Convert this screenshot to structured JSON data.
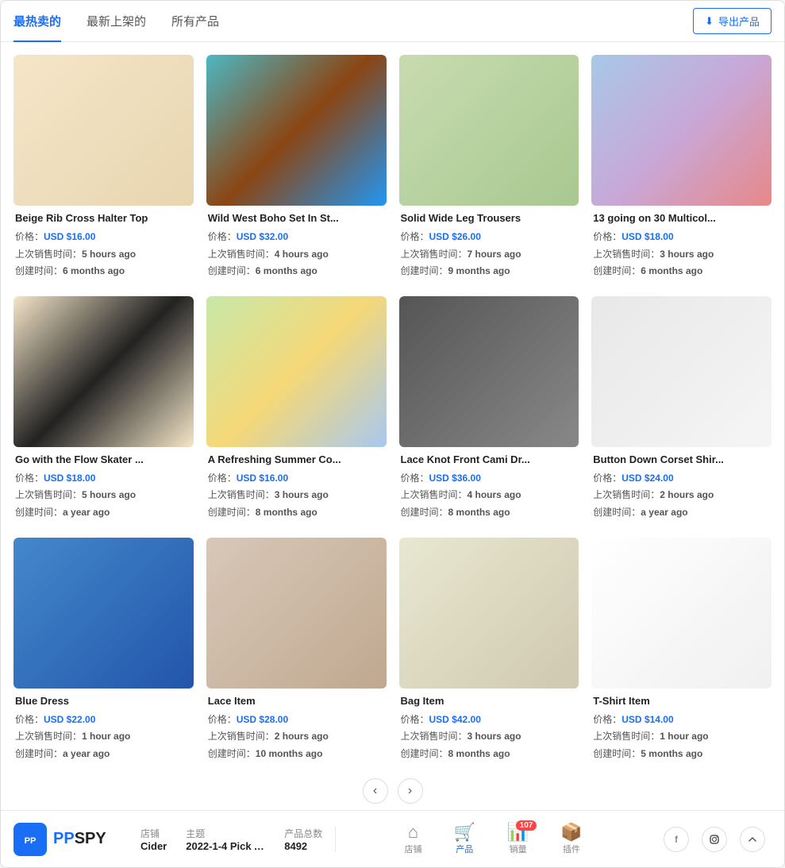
{
  "tabs": {
    "items": [
      {
        "label": "最热卖的",
        "active": true
      },
      {
        "label": "最新上架的",
        "active": false
      },
      {
        "label": "所有产品",
        "active": false
      }
    ],
    "export_label": "导出产品"
  },
  "products": [
    {
      "id": 1,
      "title": "Beige Rib Cross Halter Top",
      "price": "USD $16.00",
      "last_sold": "5 hours ago",
      "created": "6 months ago",
      "img_class": "img-beige-halter"
    },
    {
      "id": 2,
      "title": "Wild West Boho Set In St...",
      "price": "USD $32.00",
      "last_sold": "4 hours ago",
      "created": "6 months ago",
      "img_class": "img-boho-set"
    },
    {
      "id": 3,
      "title": "Solid Wide Leg Trousers",
      "price": "USD $26.00",
      "last_sold": "7 hours ago",
      "created": "9 months ago",
      "img_class": "img-trousers"
    },
    {
      "id": 4,
      "title": "13 going on 30 Multicol...",
      "price": "USD $18.00",
      "last_sold": "3 hours ago",
      "created": "6 months ago",
      "img_class": "img-multicolor"
    },
    {
      "id": 5,
      "title": "Go with the Flow Skater ...",
      "price": "USD $18.00",
      "last_sold": "5 hours ago",
      "created": "a year ago",
      "img_class": "img-skater"
    },
    {
      "id": 6,
      "title": "A Refreshing Summer Co...",
      "price": "USD $16.00",
      "last_sold": "3 hours ago",
      "created": "8 months ago",
      "img_class": "img-summer-co"
    },
    {
      "id": 7,
      "title": "Lace Knot Front Cami Dr...",
      "price": "USD $36.00",
      "last_sold": "4 hours ago",
      "created": "8 months ago",
      "img_class": "img-cami"
    },
    {
      "id": 8,
      "title": "Button Down Corset Shir...",
      "price": "USD $24.00",
      "last_sold": "2 hours ago",
      "created": "a year ago",
      "img_class": "img-corset"
    },
    {
      "id": 9,
      "title": "Blue Dress",
      "price": "USD $22.00",
      "last_sold": "1 hour ago",
      "created": "a year ago",
      "img_class": "img-blue-dress"
    },
    {
      "id": 10,
      "title": "Lace Item",
      "price": "USD $28.00",
      "last_sold": "2 hours ago",
      "created": "10 months ago",
      "img_class": "img-lace"
    },
    {
      "id": 11,
      "title": "Bag Item",
      "price": "USD $42.00",
      "last_sold": "3 hours ago",
      "created": "8 months ago",
      "img_class": "img-bag"
    },
    {
      "id": 12,
      "title": "T-Shirt Item",
      "price": "USD $14.00",
      "last_sold": "1 hour ago",
      "created": "5 months ago",
      "img_class": "img-tshirt"
    }
  ],
  "labels": {
    "price_label": "价格：",
    "last_sold_label": "上次销售时间：",
    "created_label": "创建时间："
  },
  "pagination": {
    "prev": "‹",
    "next": "›"
  },
  "bottom": {
    "brand": "PPSPY",
    "brand_pp": "PP",
    "store_label": "店铺",
    "store_value": "Cider",
    "theme_label": "主题",
    "theme_value": "2022-1-4 Pick A...",
    "total_label": "产品总数",
    "total_value": "8492",
    "nav_items": [
      {
        "label": "店铺",
        "icon": "🏠",
        "active": false,
        "badge": null
      },
      {
        "label": "产品",
        "icon": "🛒",
        "active": true,
        "badge": null
      },
      {
        "label": "销量",
        "icon": "📊",
        "active": false,
        "badge": "107"
      },
      {
        "label": "插件",
        "icon": "📦",
        "active": false,
        "badge": null
      }
    ]
  }
}
